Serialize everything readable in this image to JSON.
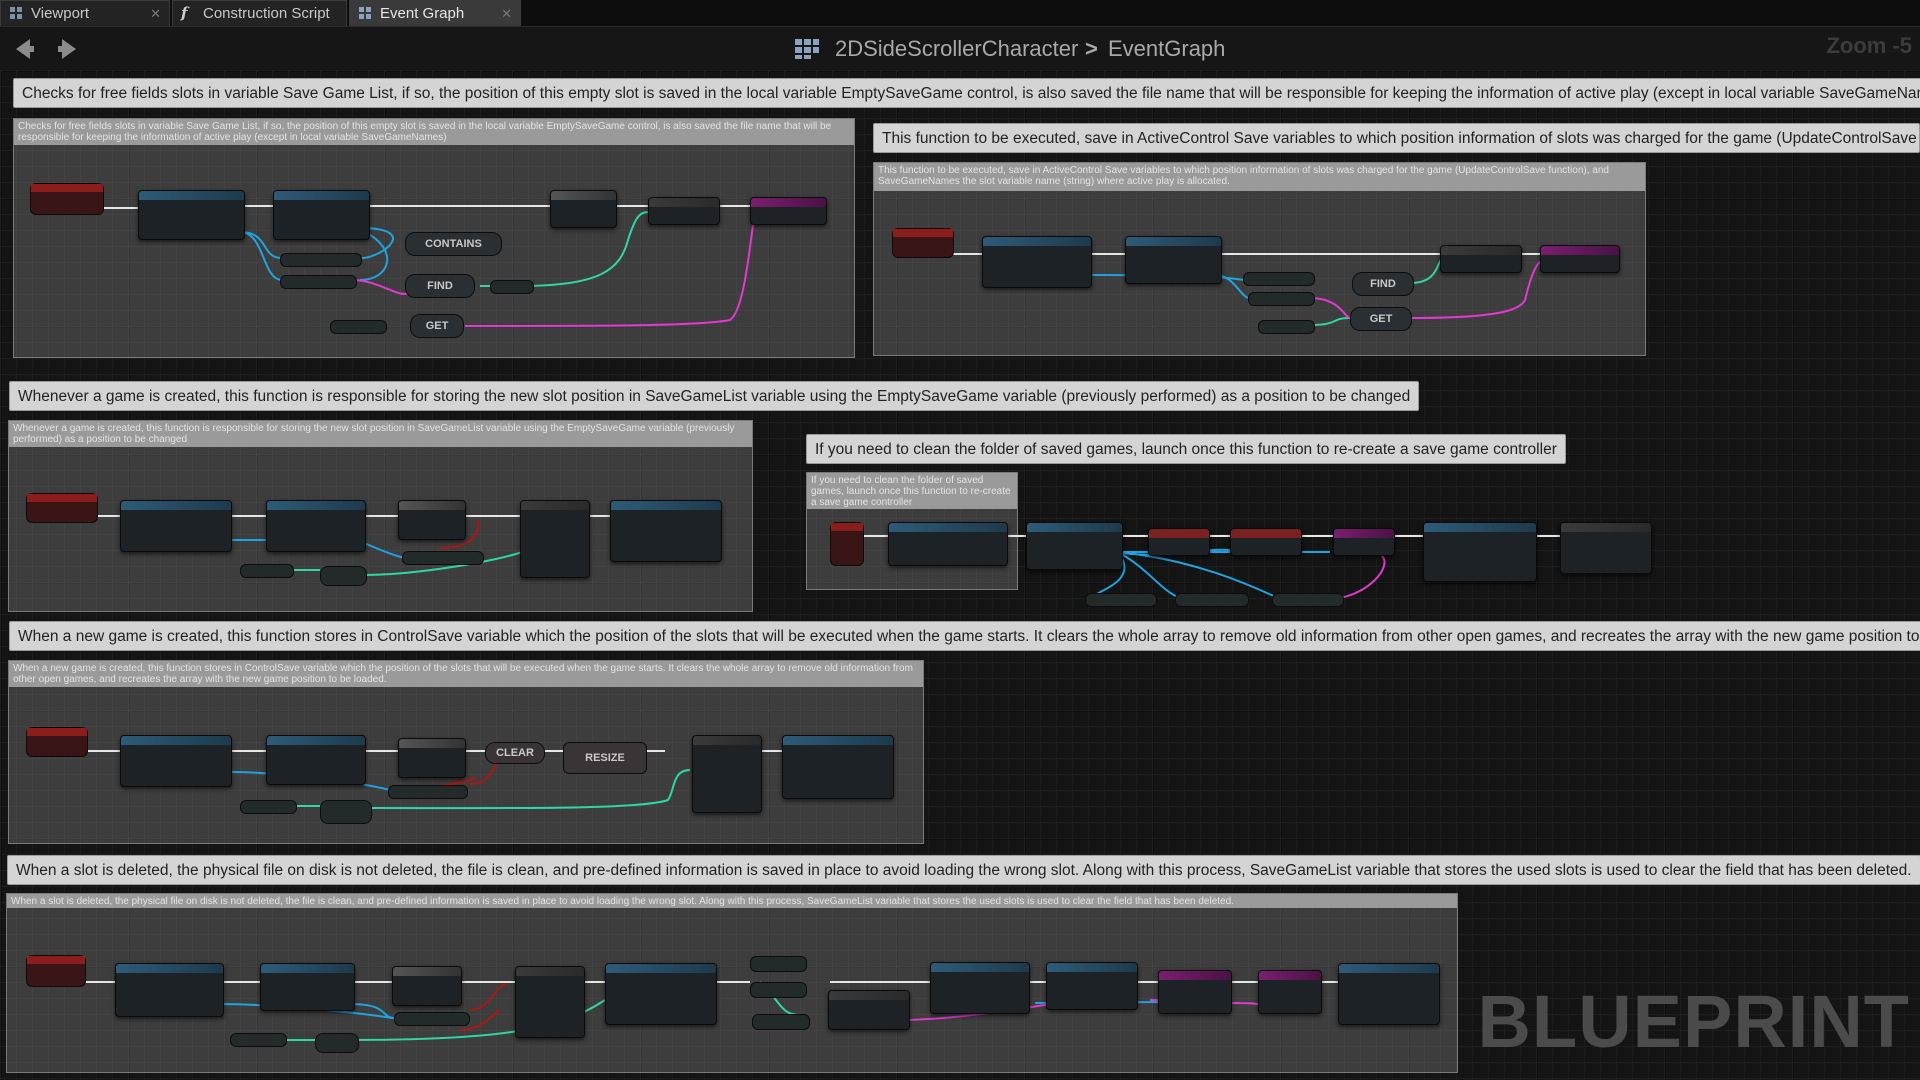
{
  "tabs": [
    {
      "label": "Viewport",
      "icon": "viewport-icon",
      "active": false
    },
    {
      "label": "Construction Script",
      "icon": "function-icon",
      "active": false
    },
    {
      "label": "Event Graph",
      "icon": "event-graph-icon",
      "active": true
    }
  ],
  "navigation": {
    "back_icon": "arrow-left-icon",
    "forward_icon": "arrow-right-icon",
    "breadcrumb_icon": "blueprint-grid-icon",
    "breadcrumb_parent": "2DSideScrollerCharacter",
    "breadcrumb_separator": ">",
    "breadcrumb_current": "EventGraph",
    "zoom_label": "Zoom -5"
  },
  "comments": [
    "Checks for free fields slots in variable Save Game List, if so, the position of this empty slot is saved in the local variable EmptySaveGame control, is also saved the file name that will be responsible for keeping the information of active play (except in local variable SaveGameNames)",
    "This function to be executed, save in ActiveControl Save variables to which position information of slots was charged for the game (UpdateControlSave function), and SaveGameNames the slot variable name (string) where active play is allocated.",
    "Whenever a game is created, this function is responsible for storing the new slot position in SaveGameList variable using the EmptySaveGame variable (previously performed) as a position to be changed",
    "If you need to clean the folder of saved games, launch once this function to re-create a save game controller",
    "When a new game is created, this function stores in ControlSave variable which the position of the slots that will be executed when the game starts. It clears the whole array to remove old information from other open games, and recreates the array with the new game position to be loaded.",
    "When a slot is deleted, the physical file on disk is not deleted, the file is clean, and pre-defined information is saved in place to avoid loading the wrong slot. Along with this process, SaveGameList variable that stores the used slots is used to clear the field that has been deleted."
  ],
  "graph_labels": {
    "contains": "CONTAINS",
    "find": "FIND",
    "get": "GET",
    "find2": "FIND",
    "get2": "GET",
    "clear": "CLEAR",
    "resize": "RESIZE"
  },
  "watermark": "BLUEPRINT",
  "colors": {
    "exec_wire": "#e8e8e8",
    "object_wire": "#1fa3e0",
    "int_wire": "#2fd6a6",
    "string_wire": "#e03ad0",
    "bool_wire": "#b01515",
    "comment_bar": "#d4d4d4",
    "background": "#141414"
  }
}
